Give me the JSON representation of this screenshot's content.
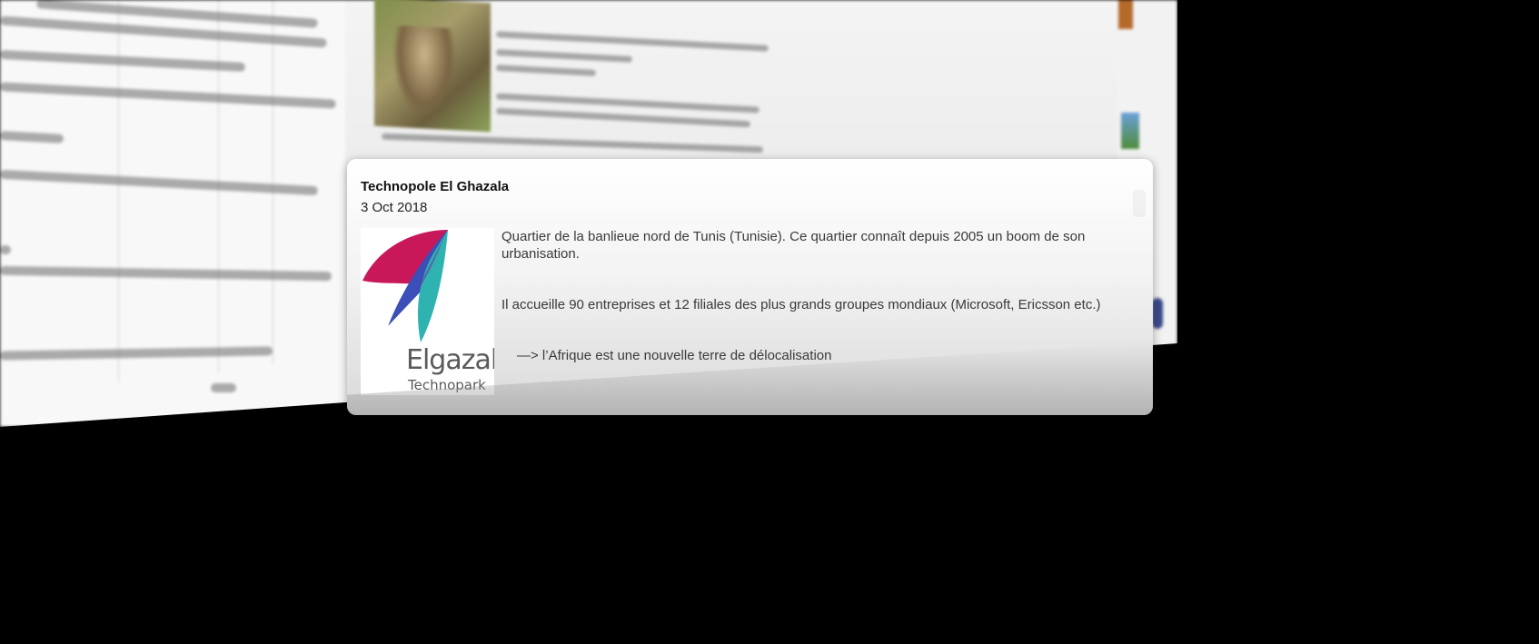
{
  "popover": {
    "title": "Technopole El Ghazala",
    "date": "3 Oct 2018",
    "image": {
      "logo_word": "Elgazala",
      "logo_sub": "Technopark"
    },
    "paragraphs": [
      "Quartier de la banlieue nord de Tunis (Tunisie). Ce quartier connaît depuis 2005 un boom de son urbanisation.",
      "Il accueille 90 entreprises et 12 filiales des plus grands groupes mondiaux (Microsoft, Ericsson etc.)",
      "—> l’Afrique est une nouvelle terre de délocalisation"
    ]
  },
  "colors": {
    "logo_magenta": "#c8185a",
    "logo_blue": "#3a4fb8",
    "logo_teal": "#2fb3b0",
    "logo_text": "#5a5a5a"
  }
}
